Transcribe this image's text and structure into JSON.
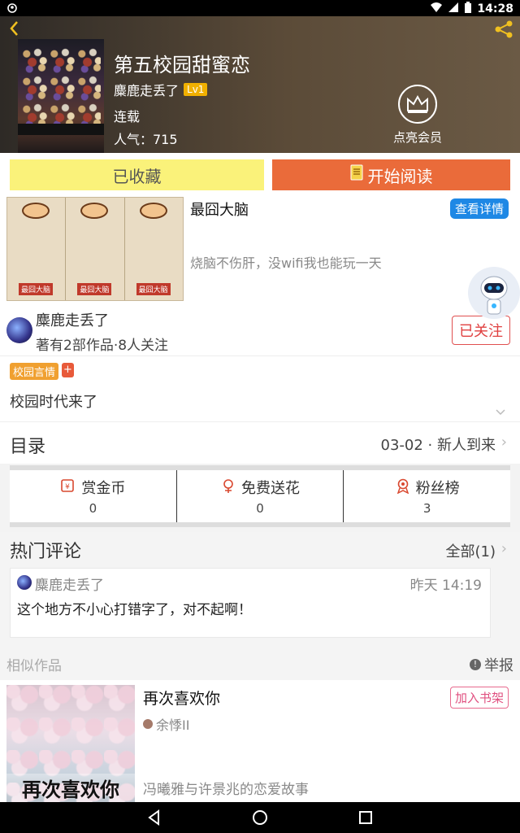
{
  "status_bar": {
    "time": "14:28"
  },
  "header": {
    "title": "第五校园甜蜜恋",
    "author": "麋鹿走丢了",
    "level": "Lv1",
    "status": "连载",
    "popularity": "人气：715",
    "member_label": "点亮会员"
  },
  "actions": {
    "favorited_label": "已收藏",
    "read_label": "开始阅读"
  },
  "ad": {
    "title": "最囧大脑",
    "desc": "烧脑不伤肝，没wifi我也能玩一天",
    "detail_button": "查看详情",
    "image_tags": [
      "最囧大脑",
      "最囧大脑",
      "最囧大脑"
    ]
  },
  "author_section": {
    "name": "麋鹿走丢了",
    "stats": "著有2部作品·8人关注",
    "follow_label": "已关注"
  },
  "tags": {
    "tag": "校园言情",
    "add": "+",
    "description": "校园时代来了"
  },
  "toc": {
    "title": "目录",
    "latest": "03-02 · 新人到来"
  },
  "stats": [
    {
      "label": "赏金币",
      "value": "0",
      "icon": "coin-icon"
    },
    {
      "label": "免费送花",
      "value": "0",
      "icon": "flower-icon"
    },
    {
      "label": "粉丝榜",
      "value": "3",
      "icon": "medal-icon"
    }
  ],
  "comments": {
    "title": "热门评论",
    "all_label": "全部(1)",
    "items": [
      {
        "user": "麋鹿走丢了",
        "time": "昨天 14:19",
        "text": "这个地方不小心打错字了，对不起啊！"
      }
    ]
  },
  "similar": {
    "title": "相似作品",
    "report_label": "举报",
    "items": [
      {
        "name": "再次喜欢你",
        "author": "余悸II",
        "desc": "冯曦雅与许景兆的恋爱故事",
        "add_label": "加入书架",
        "cover_caption": "再次喜欢你"
      }
    ]
  },
  "colors": {
    "read_button": "#ea6b3a",
    "fav_button": "#faf27a",
    "detail_button": "#1e88e5"
  }
}
